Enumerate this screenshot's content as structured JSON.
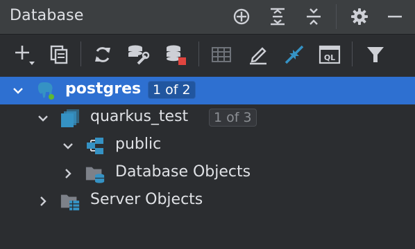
{
  "panel": {
    "title": "Database"
  },
  "colors": {
    "accent_selection": "#2e70d1",
    "background": "#2b2d30",
    "titlebar": "#3c3f41",
    "icon_blue": "#3592c4",
    "icon_red": "#e0453f"
  },
  "titlebar_icons": [
    "crosshair-icon",
    "expand-all-icon",
    "collapse-all-icon",
    "gear-icon",
    "minimize-icon"
  ],
  "toolbar_icons": [
    "add-icon",
    "duplicate-icon",
    "refresh-icon",
    "data-source-properties-icon",
    "stop-icon",
    "table-view-icon",
    "edit-icon",
    "jump-to-icon",
    "query-console-icon",
    "filter-icon"
  ],
  "toolbar": {
    "console_label": "QL"
  },
  "tree": {
    "items": [
      {
        "label": "postgres",
        "badge": "1 of 2",
        "expanded": true,
        "selected": true,
        "icon": "postgres-elephant-icon"
      },
      {
        "label": "quarkus_test",
        "badge": "1 of 3",
        "expanded": true,
        "selected": false,
        "icon": "database-icon"
      },
      {
        "label": "public",
        "expanded": true,
        "selected": false,
        "icon": "schema-icon"
      },
      {
        "label": "Database Objects",
        "expanded": false,
        "selected": false,
        "icon": "database-objects-folder-icon"
      },
      {
        "label": "Server Objects",
        "expanded": false,
        "selected": false,
        "icon": "server-objects-folder-icon"
      }
    ]
  }
}
